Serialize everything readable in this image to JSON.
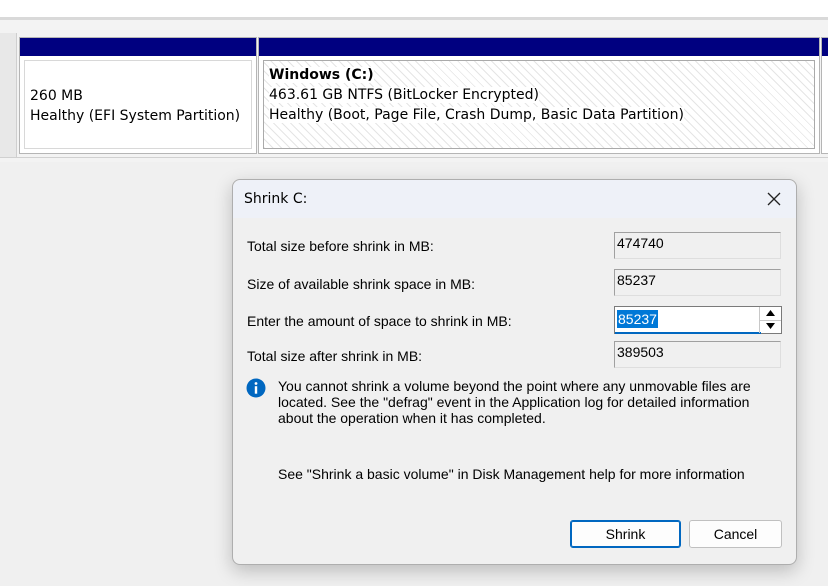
{
  "disk_view": {
    "efi_partition": {
      "size": "260 MB",
      "status": "Healthy (EFI System Partition)"
    },
    "windows_partition": {
      "name": "Windows  (C:)",
      "size_fs": "463.61 GB NTFS (BitLocker Encrypted)",
      "status": "Healthy (Boot, Page File, Crash Dump, Basic Data Partition)"
    }
  },
  "dialog": {
    "title": "Shrink C:",
    "rows": [
      {
        "label": "Total size before shrink in MB:",
        "value": "474740"
      },
      {
        "label": "Size of available shrink space in MB:",
        "value": "85237"
      },
      {
        "label": "Enter the amount of space to shrink in MB:",
        "value": "85237"
      },
      {
        "label": "Total size after shrink in MB:",
        "value": "389503"
      }
    ],
    "info_message": "You cannot shrink a volume beyond the point where any unmovable files are located. See the \"defrag\" event in the Application log for detailed information about the operation when it has completed.",
    "help_message": "See \"Shrink a basic volume\" in Disk Management help for more information",
    "buttons": {
      "shrink": "Shrink",
      "cancel": "Cancel"
    }
  },
  "icons": {
    "close": "close-icon",
    "info": "info-icon",
    "spin_up": "chevron-up-icon",
    "spin_down": "chevron-down-icon"
  },
  "colors": {
    "partition_header": "#000080",
    "selection": "#0078d7",
    "info_icon": "#0067c0"
  }
}
